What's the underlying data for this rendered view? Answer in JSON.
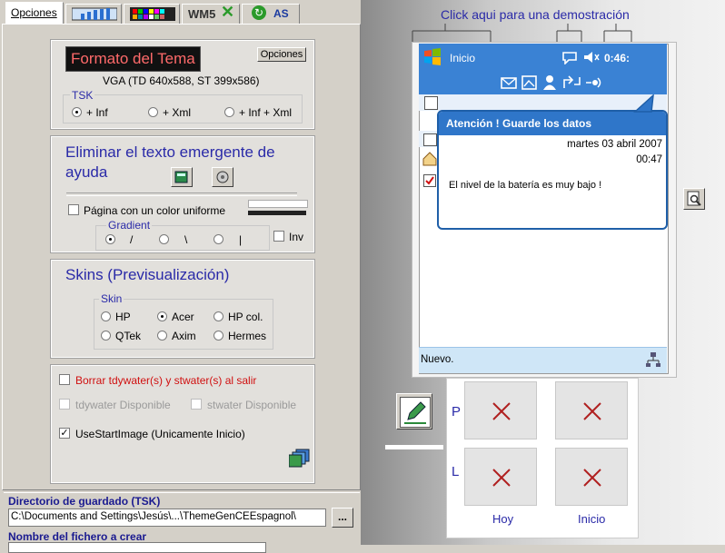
{
  "tabs": {
    "opciones": "Opciones",
    "wm5": "WM5",
    "as": "AS"
  },
  "formato": {
    "title": "Formato del Tema",
    "opciones_btn": "Opciones",
    "resolution": "VGA (TD 640x588, ST 399x586)",
    "tsk_label": "TSK",
    "tsk_options": [
      "+ Inf",
      "+ Xml",
      "+ Inf + Xml"
    ],
    "tsk_selected": 0
  },
  "eliminar": {
    "title": "Eliminar el texto emergente de ayuda",
    "uniform_color_label": "Página con un color uniforme",
    "gradient_label": "Gradient",
    "gradient_options": [
      "/",
      "\\",
      "|"
    ],
    "gradient_selected": 0,
    "inv_label": "Inv"
  },
  "skins": {
    "title": "Skins (Previsualización)",
    "skin_label": "Skin",
    "options": [
      "HP",
      "Acer",
      "HP col.",
      "QTek",
      "Axim",
      "Hermes"
    ],
    "selected": "Acer"
  },
  "options": {
    "borrar_label": "Borrar tdywater(s) y stwater(s) al salir",
    "tdywater_label": "tdywater Disponible",
    "stwater_label": "stwater Disponible",
    "usestartimage_label": "UseStartImage (Unicamente Inicio)",
    "usestartimage_checked": true
  },
  "save": {
    "dir_label": "Directorio de guardado (TSK)",
    "dir_value": "C:\\Documents and Settings\\Jesús\\...\\ThemeGenCEEspagnol\\",
    "browse_label": "...",
    "filename_label": "Nombre del fichero a crear"
  },
  "preview": {
    "demo_link": "Click aqui para una demostración",
    "title": "Inicio",
    "time": "0:46:",
    "popup_title": "Atención ! Guarde los datos",
    "popup_date": "martes 03 abril 2007",
    "popup_time": "00:47",
    "popup_message": "El nivel de la batería es muy bajo !",
    "nuevo": "Nuevo."
  },
  "tiles": {
    "row_p": "P",
    "row_l": "L",
    "col_hoy": "Hoy",
    "col_inicio": "Inicio"
  },
  "colors": {
    "ppc_blue": "#3a82d4",
    "popup_blue": "#2f76c9",
    "link_blue": "#2a2aa8",
    "red_label": "#d01010",
    "theme_title_bg": "#111111",
    "theme_title_fg": "#ff6a6a"
  }
}
